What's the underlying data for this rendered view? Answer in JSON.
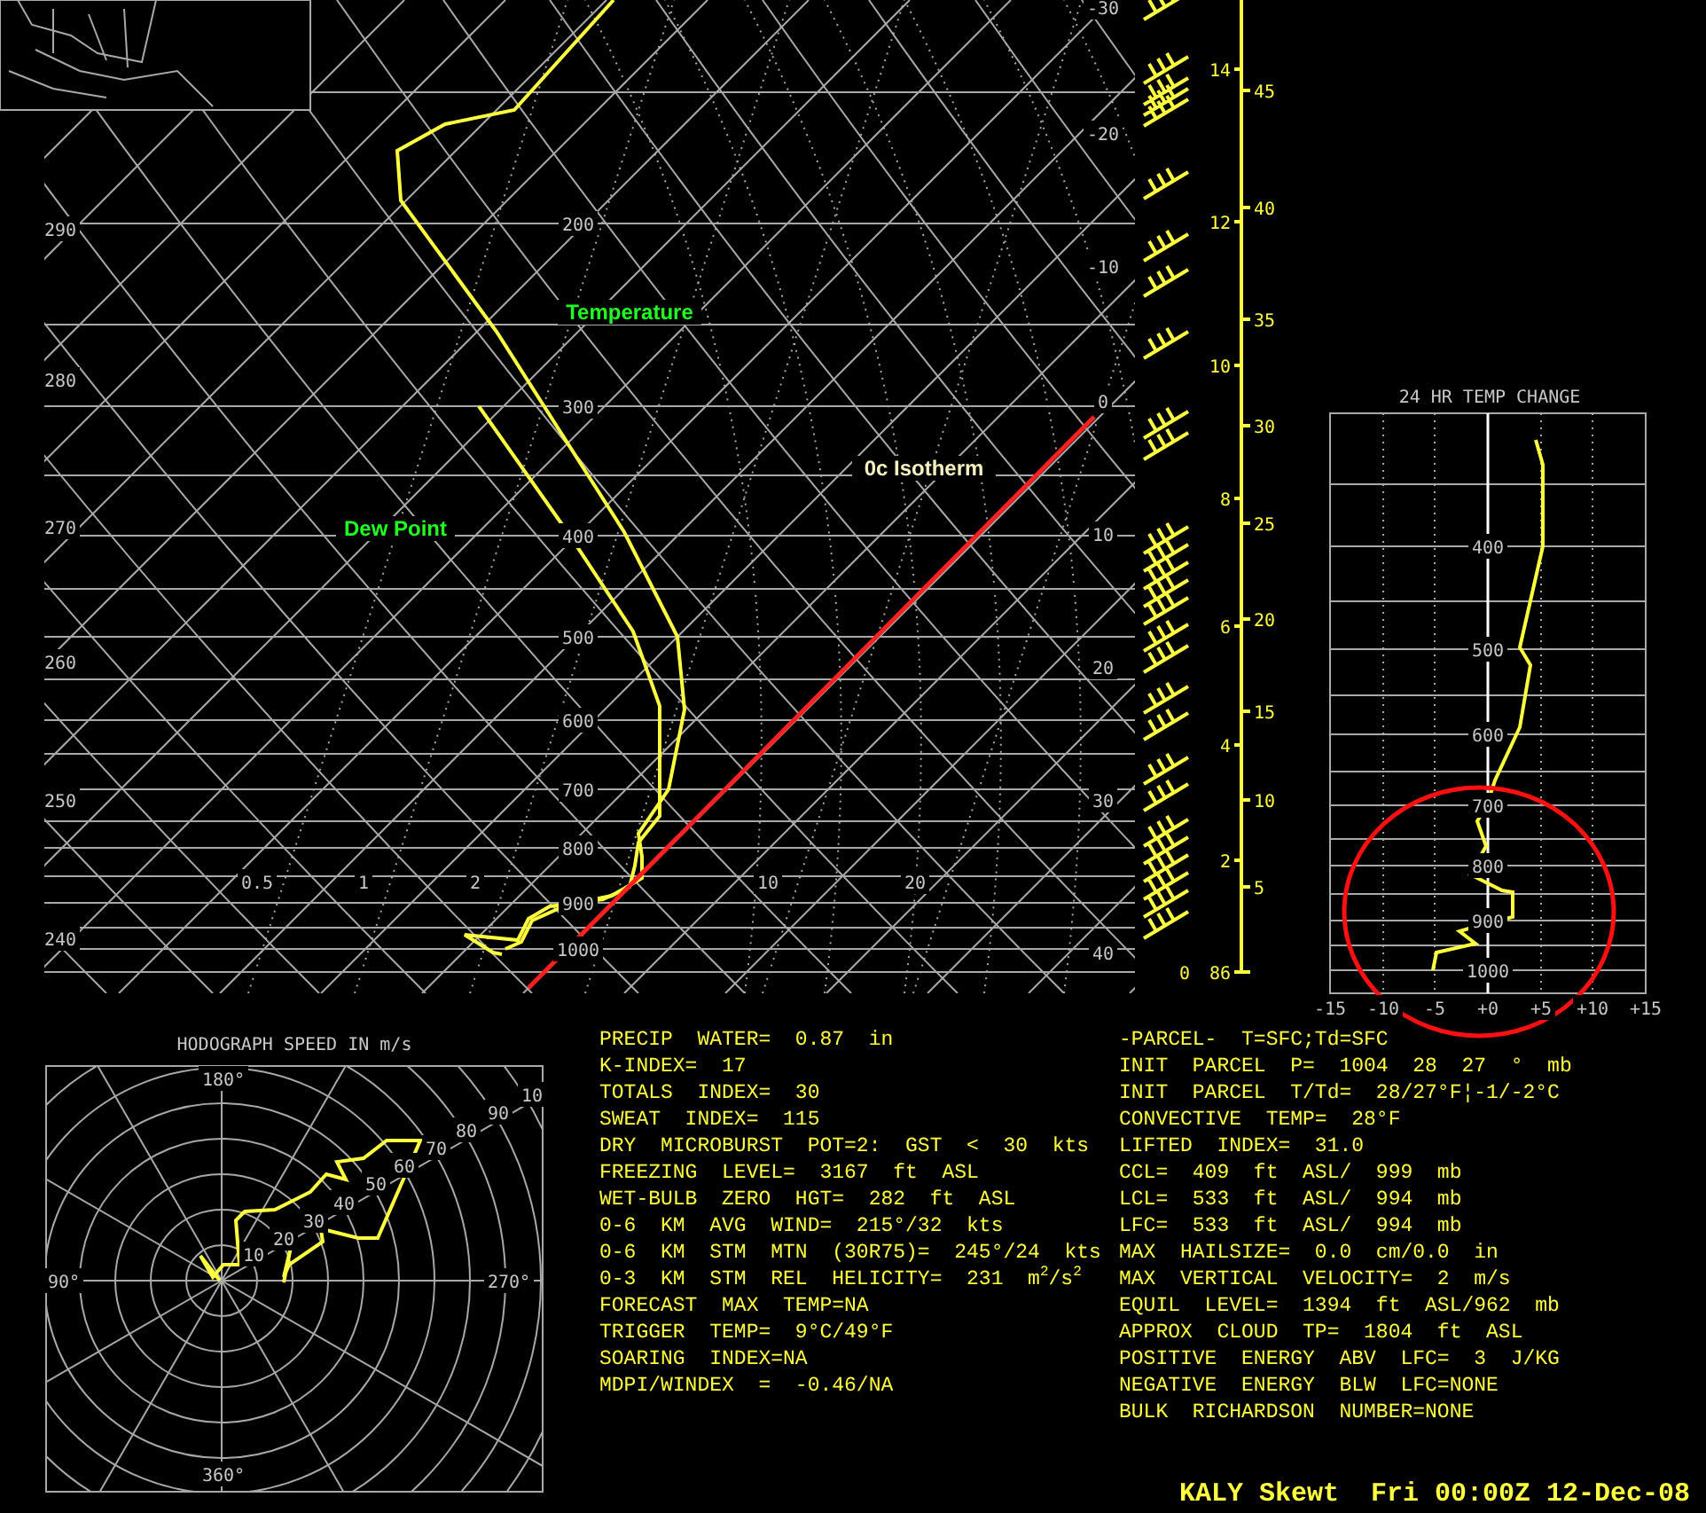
{
  "skewt": {
    "theta_labels": [
      "290",
      "280",
      "270",
      "260",
      "250",
      "240"
    ],
    "pressure_labels": [
      "200",
      "300",
      "400",
      "500",
      "600",
      "700",
      "800",
      "900",
      "1000"
    ],
    "mixing_ratio_labels": [
      "0.5",
      "1",
      "2",
      "10",
      "20"
    ],
    "temperature_labels": [
      "-30",
      "-20",
      "-10",
      "0",
      "10",
      "20",
      "30",
      "40"
    ],
    "trace_labels": {
      "temperature": "Temperature",
      "dew_point": "Dew Point",
      "isotherm": "0c Isotherm"
    }
  },
  "height_axis": {
    "km_labels": [
      "14",
      "12",
      "10",
      "8",
      "6",
      "4",
      "2",
      "0"
    ],
    "kft_labels": [
      "45",
      "40",
      "35",
      "30",
      "25",
      "20",
      "15",
      "10",
      "5",
      "86"
    ]
  },
  "temp_change": {
    "title": "24 HR TEMP CHANGE",
    "pressure_labels": [
      "400",
      "500",
      "600",
      "700",
      "800",
      "900",
      "1000"
    ],
    "x_labels": [
      "-15",
      "-10",
      "-5",
      "+0",
      "+5",
      "+10",
      "+15"
    ]
  },
  "hodograph": {
    "title": "HODOGRAPH SPEED IN m/s",
    "direction_labels": [
      "180°",
      "90°",
      "270°",
      "360°"
    ],
    "speed_labels": [
      "10",
      "20",
      "30",
      "40",
      "50",
      "60",
      "70",
      "80",
      "90",
      "10"
    ]
  },
  "indices_left": [
    "PRECIP  WATER=  0.87  in",
    "K-INDEX=  17",
    "TOTALS  INDEX=  30",
    "SWEAT  INDEX=  115",
    "DRY  MICROBURST  POT=2:  GST  <  30  kts",
    "FREEZING  LEVEL=  3167  ft  ASL",
    "WET-BULB  ZERO  HGT=  282  ft  ASL",
    "0-6  KM  AVG  WIND=  215°/32  kts",
    "0-6  KM  STM  MTN  (30R75)=  245°/24  kts",
    "0-3  KM  STM  REL  HELICITY=  231  m$^{2}$/s$^{2}$",
    "FORECAST  MAX  TEMP=NA",
    "TRIGGER  TEMP=  9°C/49°F",
    "SOARING  INDEX=NA",
    "MDPI/WINDEX  =  -0.46/NA"
  ],
  "indices_right": [
    "-PARCEL-  T=SFC;Td=SFC",
    "INIT  PARCEL  P=  1004  28  27  °  mb",
    "INIT  PARCEL  T/Td=  28/27°F¦-1/-2°C",
    "CONVECTIVE  TEMP=  28°F",
    "LIFTED  INDEX=  31.0",
    "CCL=  409  ft  ASL/  999  mb",
    "LCL=  533  ft  ASL/  994  mb",
    "LFC=  533  ft  ASL/  994  mb",
    "MAX  HAILSIZE=  0.0  cm/0.0  in",
    "MAX  VERTICAL  VELOCITY=  2  m/s",
    "EQUIL  LEVEL=  1394  ft  ASL/962  mb",
    "APPROX  CLOUD  TP=  1804  ft  ASL",
    "POSITIVE  ENERGY  ABV  LFC=  3  J/KG",
    "NEGATIVE  ENERGY  BLW  LFC=NONE",
    "BULK  RICHARDSON  NUMBER=NONE"
  ],
  "footer": "KALY Skewt  Fri 00:00Z 12-Dec-08"
}
